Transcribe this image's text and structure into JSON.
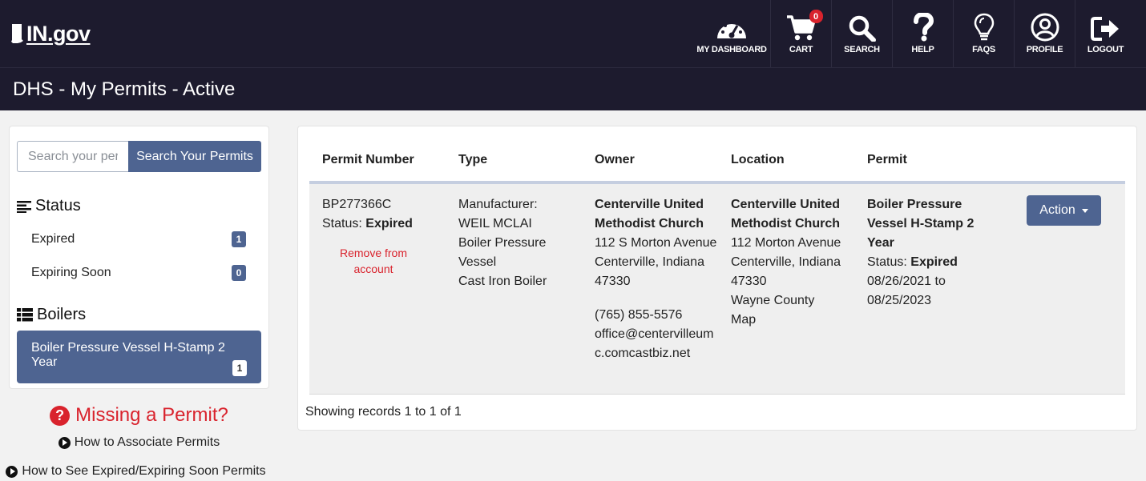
{
  "header": {
    "logo_text": "IN.gov",
    "nav": [
      {
        "label": "MY DASHBOARD",
        "icon": "dashboard-gauge-icon"
      },
      {
        "label": "CART",
        "icon": "cart-icon",
        "badge": "0"
      },
      {
        "label": "SEARCH",
        "icon": "search-icon"
      },
      {
        "label": "HELP",
        "icon": "question-icon"
      },
      {
        "label": "FAQS",
        "icon": "lightbulb-icon"
      },
      {
        "label": "PROFILE",
        "icon": "user-circle-icon"
      },
      {
        "label": "LOGOUT",
        "icon": "logout-icon"
      }
    ]
  },
  "page_title": "DHS - My Permits - Active",
  "sidebar": {
    "search_placeholder": "Search your per",
    "search_button": "Search Your Permits",
    "status_heading": "Status",
    "status_items": [
      {
        "label": "Expired",
        "count": "1"
      },
      {
        "label": "Expiring Soon",
        "count": "0"
      }
    ],
    "boilers_heading": "Boilers",
    "boiler_item": {
      "label": "Boiler Pressure Vessel H-Stamp 2 Year",
      "count": "1"
    }
  },
  "missing": {
    "heading": "Missing a Permit?",
    "link1": "How to Associate Permits",
    "link2": "How to See Expired/Expiring Soon Permits"
  },
  "table": {
    "headers": [
      "Permit Number",
      "Type",
      "Owner",
      "Location",
      "Permit"
    ],
    "row": {
      "permit_number": "BP277366C",
      "status_label": "Status:",
      "status_value": "Expired",
      "remove_link": "Remove from account",
      "type_lines": [
        "Manufacturer:",
        "WEIL MCLAI",
        "Boiler Pressure",
        "Vessel",
        "Cast Iron Boiler"
      ],
      "owner_name": "Centerville United Methodist Church",
      "owner_address": "112 S Morton Avenue",
      "owner_city": "Centerville, Indiana 47330",
      "owner_phone": "(765) 855-5576",
      "owner_email": "office@centervilleumc.comcastbiz.net",
      "location_name": "Centerville United Methodist Church",
      "location_address": "112 Morton Avenue",
      "location_city": "Centerville, Indiana 47330",
      "location_county": "Wayne County",
      "location_map": "Map",
      "permit_name": "Boiler Pressure Vessel H-Stamp 2 Year",
      "permit_status_label": "Status:",
      "permit_status_value": "Expired",
      "permit_dates": "08/26/2021 to 08/25/2023",
      "action_label": "Action"
    },
    "footer": "Showing records 1 to 1 of 1"
  },
  "colors": {
    "header_bg": "#1d1b2e",
    "accent": "#4e6491",
    "danger": "#d9232d"
  }
}
